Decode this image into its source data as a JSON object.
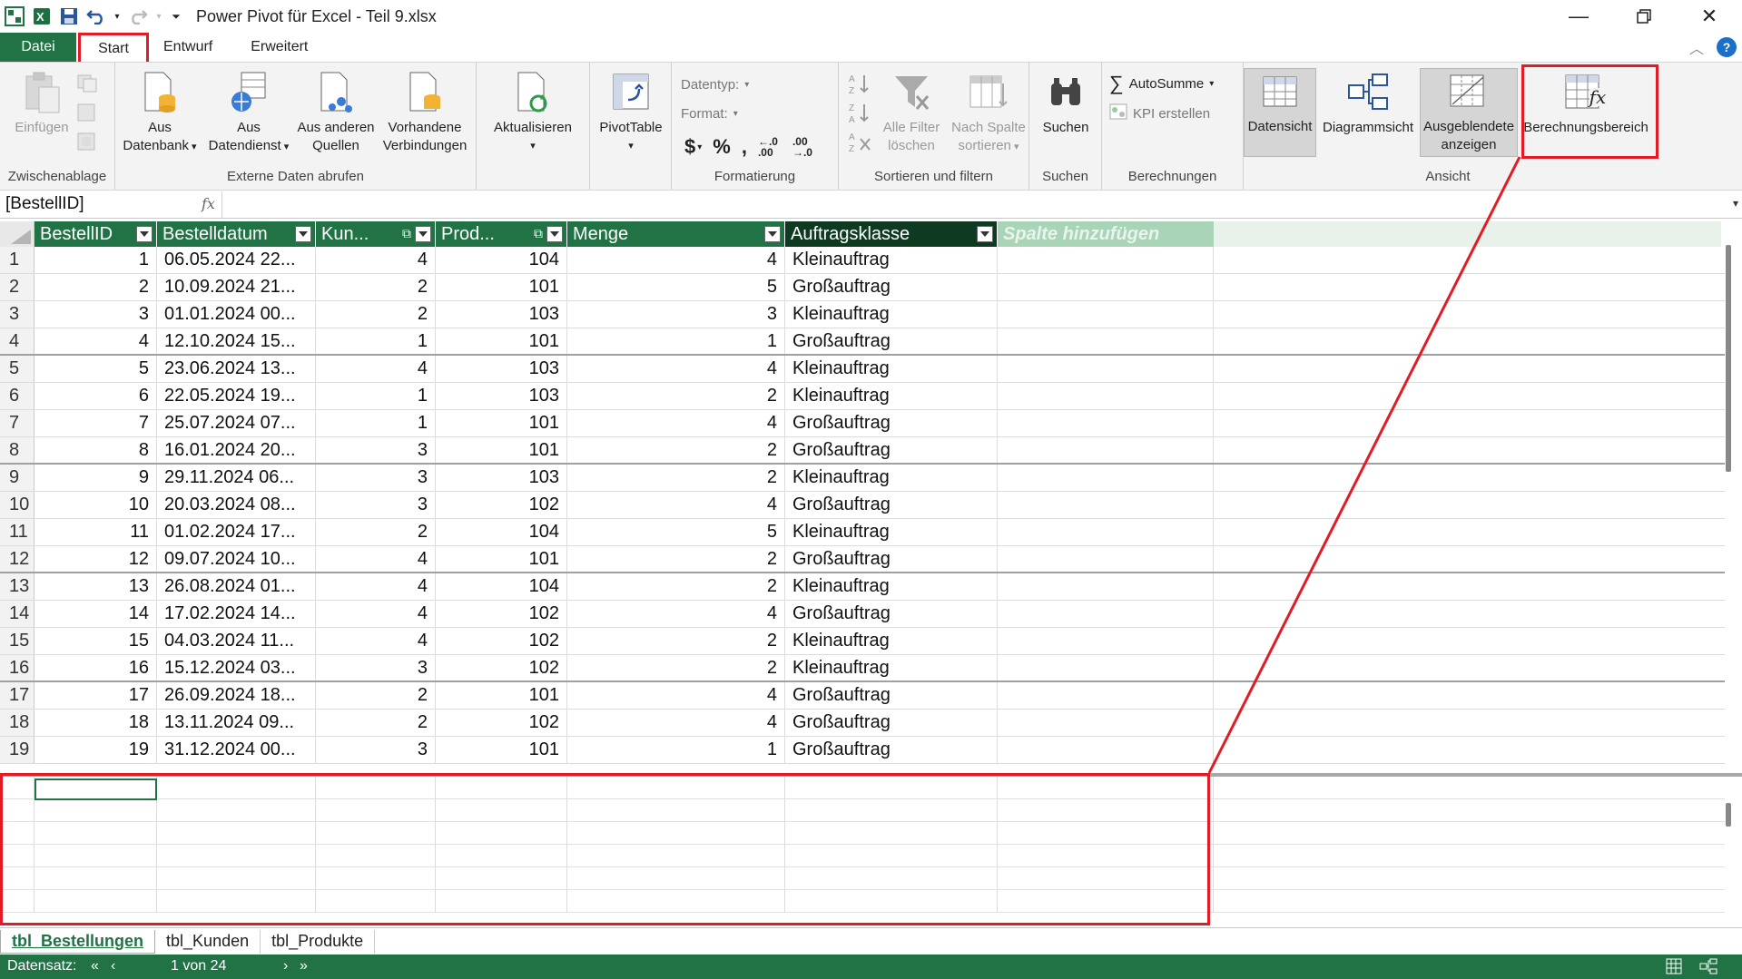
{
  "app": {
    "title": "Power Pivot für Excel - Teil 9.xlsx"
  },
  "ribbon_tabs": [
    {
      "label": "Datei"
    },
    {
      "label": "Start"
    },
    {
      "label": "Entwurf"
    },
    {
      "label": "Erweitert"
    }
  ],
  "ribbon": {
    "zwischenablage": {
      "label": "Zwischenablage",
      "einfuegen": "Einfügen"
    },
    "externe": {
      "label": "Externe Daten abrufen",
      "aus_datenbank_1": "Aus",
      "aus_datenbank_2": "Datenbank",
      "aus_datendienst_1": "Aus",
      "aus_datendienst_2": "Datendienst",
      "aus_anderen_1": "Aus anderen",
      "aus_anderen_2": "Quellen",
      "vorhandene_1": "Vorhandene",
      "vorhandene_2": "Verbindungen"
    },
    "aktualisieren": "Aktualisieren",
    "pivottable": "PivotTable",
    "formatierung": {
      "label": "Formatierung",
      "datentyp": "Datentyp:",
      "format": "Format:",
      "currency": "$",
      "percent": "%",
      "comma": ",",
      "inc_dec": "←.0 .00",
      "dec_dec": ".00 →.0"
    },
    "sortieren": {
      "label": "Sortieren und filtern",
      "alle_filter_1": "Alle Filter",
      "alle_filter_2": "löschen",
      "nach_spalte_1": "Nach Spalte",
      "nach_spalte_2": "sortieren"
    },
    "suchen": {
      "label": "Suchen",
      "button": "Suchen"
    },
    "berechnungen": {
      "label": "Berechnungen",
      "autosumme": "AutoSumme",
      "sigma": "∑",
      "kpi": "KPI erstellen"
    },
    "ansicht": {
      "label": "Ansicht",
      "datensicht": "Datensicht",
      "diagrammsicht": "Diagrammsicht",
      "ausgeblendete_1": "Ausgeblendete",
      "ausgeblendete_2": "anzeigen",
      "berechnungsbereich": "Berechnungsbereich",
      "fx": "fx"
    }
  },
  "formula_bar": {
    "name_box": "[BestellID]",
    "fx": "fx"
  },
  "columns": [
    {
      "label": "BestellID"
    },
    {
      "label": "Bestelldatum"
    },
    {
      "label": "Kun..."
    },
    {
      "label": "Prod..."
    },
    {
      "label": "Menge"
    },
    {
      "label": "Auftragsklasse"
    },
    {
      "label": "Spalte hinzufügen"
    }
  ],
  "rows": [
    [
      "1",
      "1",
      "06.05.2024 22...",
      "4",
      "104",
      "4",
      "Kleinauftrag"
    ],
    [
      "2",
      "2",
      "10.09.2024 21...",
      "2",
      "101",
      "5",
      "Großauftrag"
    ],
    [
      "3",
      "3",
      "01.01.2024 00...",
      "2",
      "103",
      "3",
      "Kleinauftrag"
    ],
    [
      "4",
      "4",
      "12.10.2024 15...",
      "1",
      "101",
      "1",
      "Großauftrag"
    ],
    [
      "5",
      "5",
      "23.06.2024 13...",
      "4",
      "103",
      "4",
      "Kleinauftrag"
    ],
    [
      "6",
      "6",
      "22.05.2024 19...",
      "1",
      "103",
      "2",
      "Kleinauftrag"
    ],
    [
      "7",
      "7",
      "25.07.2024 07...",
      "1",
      "101",
      "4",
      "Großauftrag"
    ],
    [
      "8",
      "8",
      "16.01.2024 20...",
      "3",
      "101",
      "2",
      "Großauftrag"
    ],
    [
      "9",
      "9",
      "29.11.2024 06...",
      "3",
      "103",
      "2",
      "Kleinauftrag"
    ],
    [
      "10",
      "10",
      "20.03.2024 08...",
      "3",
      "102",
      "4",
      "Großauftrag"
    ],
    [
      "11",
      "11",
      "01.02.2024 17...",
      "2",
      "104",
      "5",
      "Kleinauftrag"
    ],
    [
      "12",
      "12",
      "09.07.2024 10...",
      "4",
      "101",
      "2",
      "Großauftrag"
    ],
    [
      "13",
      "13",
      "26.08.2024 01...",
      "4",
      "104",
      "2",
      "Kleinauftrag"
    ],
    [
      "14",
      "14",
      "17.02.2024 14...",
      "4",
      "102",
      "4",
      "Großauftrag"
    ],
    [
      "15",
      "15",
      "04.03.2024 11...",
      "4",
      "102",
      "2",
      "Kleinauftrag"
    ],
    [
      "16",
      "16",
      "15.12.2024 03...",
      "3",
      "102",
      "2",
      "Kleinauftrag"
    ],
    [
      "17",
      "17",
      "26.09.2024 18...",
      "2",
      "101",
      "4",
      "Großauftrag"
    ],
    [
      "18",
      "18",
      "13.11.2024 09...",
      "2",
      "102",
      "4",
      "Großauftrag"
    ],
    [
      "19",
      "19",
      "31.12.2024 00...",
      "3",
      "101",
      "1",
      "Großauftrag"
    ]
  ],
  "sheet_tabs": [
    {
      "label": "tbl_Bestellungen"
    },
    {
      "label": "tbl_Kunden"
    },
    {
      "label": "tbl_Produkte"
    }
  ],
  "status": {
    "datensatz": "Datensatz:",
    "nav_first": "«",
    "nav_prev": "‹",
    "position": "1 von 24",
    "nav_next": "›",
    "nav_last": "»"
  },
  "colors": {
    "accent": "#217346",
    "highlight": "#e21b24"
  }
}
